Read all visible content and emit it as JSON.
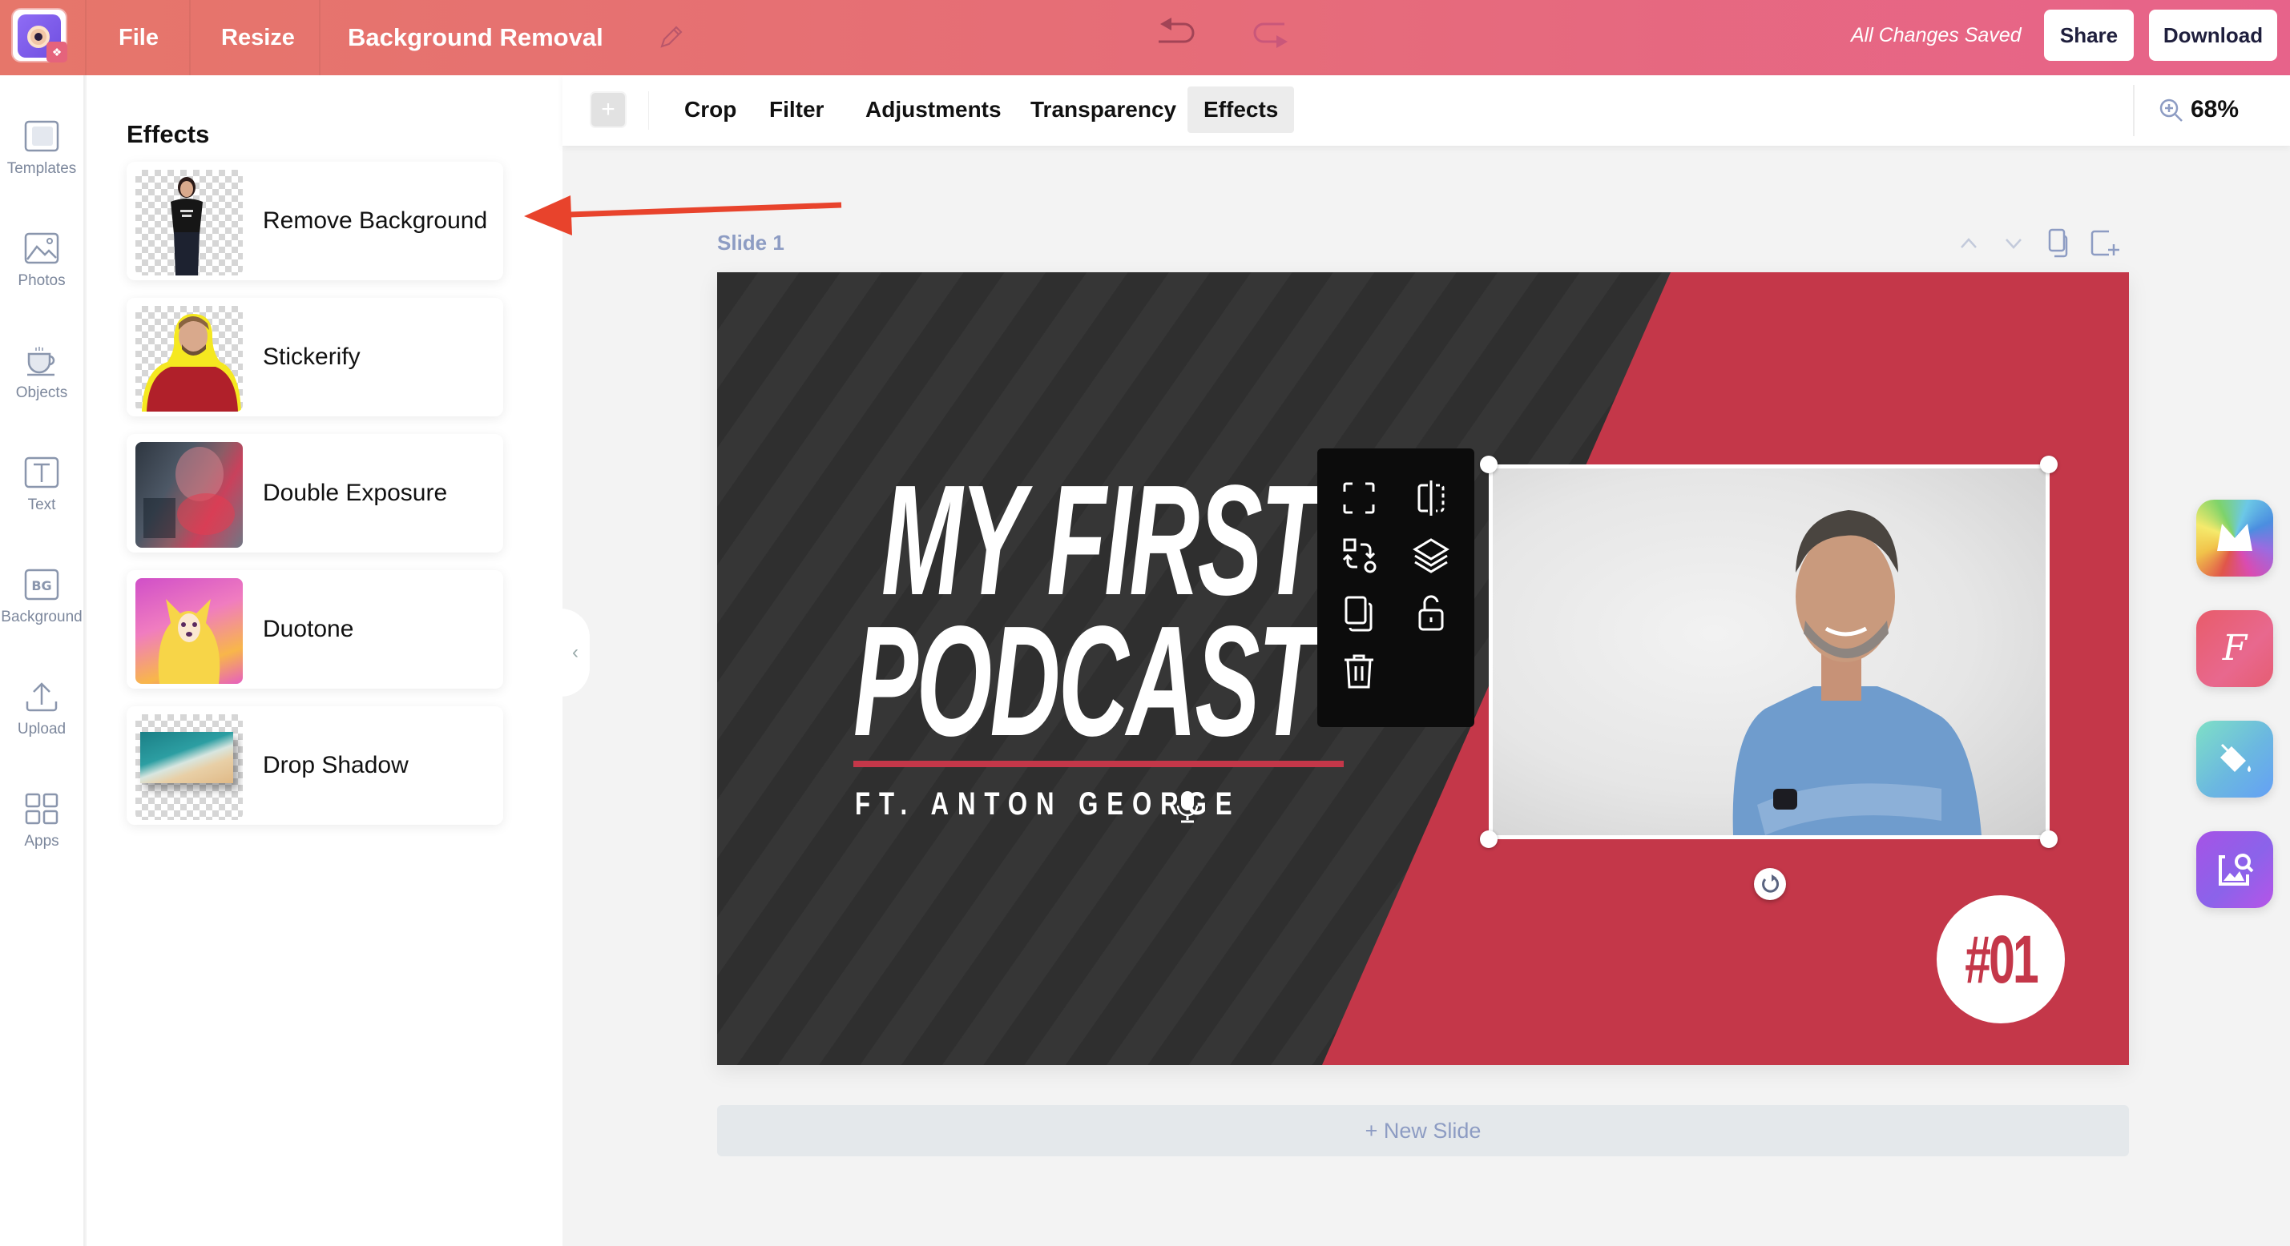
{
  "app": {
    "document_title": "Background Removal",
    "menu": {
      "file": "File",
      "resize": "Resize"
    },
    "status": "All Changes Saved",
    "buttons": {
      "share": "Share",
      "download": "Download"
    },
    "colors": {
      "topbar_start": "#e6766a",
      "topbar_end": "#e7638a",
      "slide_red": "#c43749",
      "annotation_arrow": "#e8432c"
    }
  },
  "rail": {
    "items": [
      {
        "label": "Templates",
        "icon": "templates-icon"
      },
      {
        "label": "Photos",
        "icon": "photo-icon"
      },
      {
        "label": "Objects",
        "icon": "cup-icon"
      },
      {
        "label": "Text",
        "icon": "text-icon"
      },
      {
        "label": "Background",
        "icon": "bg-icon",
        "badge": "BG"
      },
      {
        "label": "Upload",
        "icon": "upload-icon"
      },
      {
        "label": "Apps",
        "icon": "apps-icon"
      }
    ]
  },
  "panel": {
    "title": "Effects",
    "effects": [
      {
        "label": "Remove Background"
      },
      {
        "label": "Stickerify"
      },
      {
        "label": "Double Exposure"
      },
      {
        "label": "Duotone"
      },
      {
        "label": "Drop Shadow"
      }
    ]
  },
  "subtoolbar": {
    "add_button": "+",
    "tabs": [
      {
        "label": "Crop",
        "active": false
      },
      {
        "label": "Filter",
        "active": false
      },
      {
        "label": "Adjustments",
        "active": false
      },
      {
        "label": "Transparency",
        "active": false
      },
      {
        "label": "Effects",
        "active": true
      }
    ],
    "zoom_level": "68%"
  },
  "canvas": {
    "slide_label": "Slide 1",
    "new_slide": "+ New Slide",
    "slide": {
      "title_line1": "MY FIRST",
      "title_line2": "PODCAST",
      "subtitle": "FT. ANTON GEORGE",
      "episode_badge": "#01"
    },
    "object_toolbar": [
      "crop-icon",
      "flip-icon",
      "replace-icon",
      "layers-icon",
      "duplicate-icon",
      "unlock-icon",
      "delete-icon"
    ]
  },
  "right_apps": [
    {
      "name": "app-launcher",
      "glyph": "M"
    },
    {
      "name": "font-app",
      "glyph": "F"
    },
    {
      "name": "fill-app",
      "glyph": ""
    },
    {
      "name": "image-search-app",
      "glyph": ""
    }
  ]
}
